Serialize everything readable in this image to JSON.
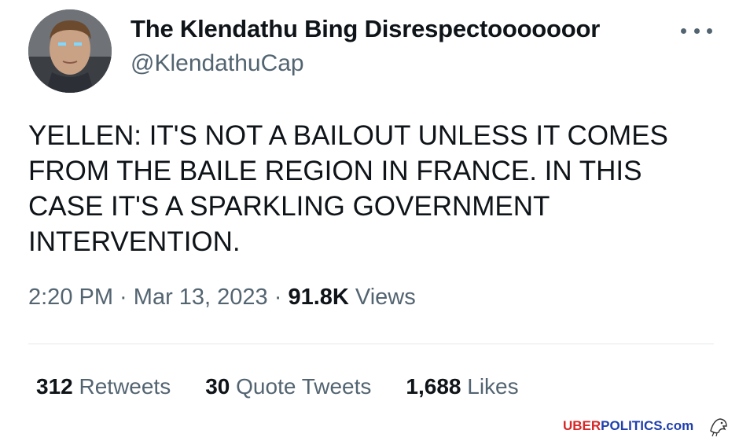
{
  "tweet": {
    "display_name": "The Klendathu Bing Disrespectooooooor",
    "handle": "@KlendathuCap",
    "text": "YELLEN: IT'S NOT A BAILOUT UNLESS IT COMES FROM THE BAILE REGION IN FRANCE. IN THIS CASE IT'S A SPARKLING GOVERNMENT INTERVENTION.",
    "time": "2:20 PM",
    "separator1": " · ",
    "date": "Mar 13, 2023",
    "separator2": " · ",
    "views_count": "91.8K",
    "views_label": " Views"
  },
  "stats": {
    "retweets_count": "312",
    "retweets_label": " Retweets",
    "quotes_count": "30",
    "quotes_label": " Quote Tweets",
    "likes_count": "1,688",
    "likes_label": " Likes"
  },
  "watermark": {
    "part1": "UBER",
    "part2": "POLITICS.com"
  },
  "icons": {
    "more": "more-options-icon",
    "avatar": "avatar",
    "watermark_logo": "eagle-icon"
  },
  "colors": {
    "text": "#0f1419",
    "secondary": "#536471",
    "divider": "#e4e8eb",
    "watermark_red": "#d62828",
    "watermark_blue": "#1f3fae"
  }
}
